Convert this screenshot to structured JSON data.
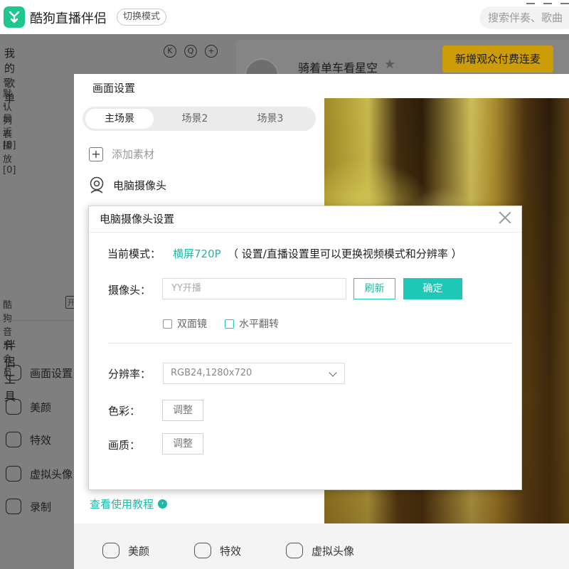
{
  "app": {
    "title": "酷狗直播伴侣",
    "mode_button": "切换模式",
    "search_placeholder": "搜索伴奏、歌曲",
    "logo_icon": "kugou-music-logo-icon",
    "accent_color": "#1fc78d"
  },
  "sidebar": {
    "title": "我的歌单",
    "icons": [
      "k-icon",
      "q-icon",
      "add-icon"
    ],
    "playlists": [
      {
        "label": "默认列表 [0]"
      },
      {
        "label": "最近播放 [0]"
      }
    ],
    "member_label": "酷狗音乐会员",
    "member_tag": "开",
    "tools_title": "伴侣工具",
    "tools": [
      {
        "label": "画面设置",
        "icon": "screen-settings-icon"
      },
      {
        "label": "美颜",
        "icon": "beauty-icon"
      },
      {
        "label": "特效",
        "icon": "effects-icon"
      },
      {
        "label": "虚拟头像",
        "icon": "virtual-avatar-icon"
      },
      {
        "label": "录制",
        "icon": "record-icon"
      }
    ]
  },
  "header": {
    "host_name": "骑着单车看星空",
    "linkmic_button": "新增观众付费连麦",
    "linkmic_color": "#cc9d08"
  },
  "scene_panel": {
    "title": "画面设置",
    "tabs": [
      {
        "label": "主场景",
        "active": true
      },
      {
        "label": "场景2",
        "active": false
      },
      {
        "label": "场景3",
        "active": false
      }
    ],
    "add_material": "添加素材",
    "camera_source": "电脑摄像头",
    "tutorial_link": "查看使用教程",
    "bottom_tools": [
      {
        "label": "美颜",
        "icon": "beauty-icon"
      },
      {
        "label": "特效",
        "icon": "effects-icon"
      },
      {
        "label": "虚拟头像",
        "icon": "virtual-avatar-icon"
      }
    ]
  },
  "camera_dialog": {
    "title": "电脑摄像头设置",
    "mode_label": "当前模式：",
    "mode_value": "横屏720P",
    "mode_hint": "（ 设置/直播设置里可以更换视频模式和分辨率 ）",
    "camera_label": "摄像头：",
    "camera_placeholder": "YY开播",
    "refresh_button": "刷新",
    "confirm_button": "确定",
    "mirror_label": "双面镜",
    "flip_label": "水平翻转",
    "resolution_label": "分辨率：",
    "resolution_value": "RGB24,1280x720",
    "color_label": "色彩：",
    "quality_label": "画质：",
    "adjust_button": "调整",
    "accent_color": "#1fc7b6"
  }
}
